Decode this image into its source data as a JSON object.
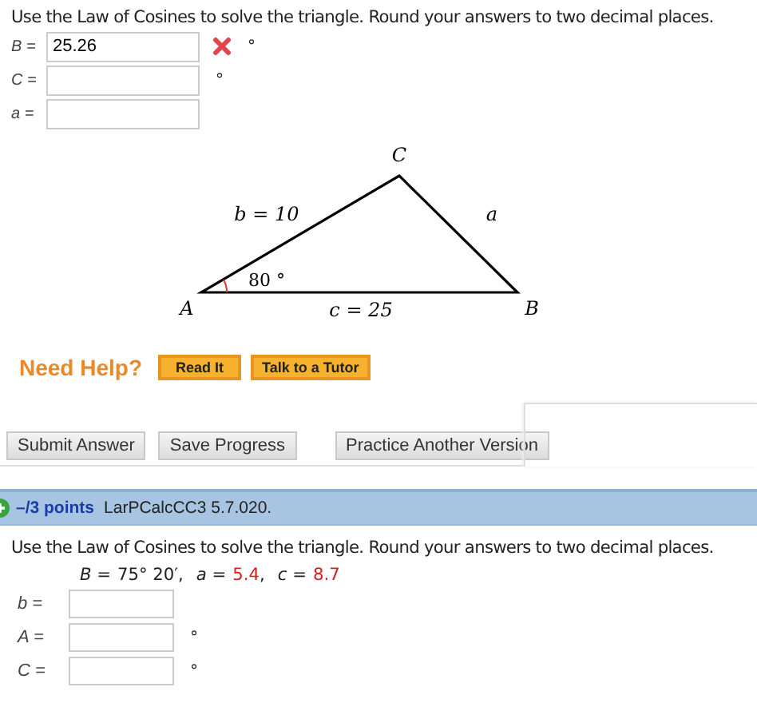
{
  "question_1": {
    "instruction": "Use the Law of Cosines to solve the triangle. Round your answers to two decimal places.",
    "fields": [
      {
        "label": "B =",
        "value": "25.26",
        "unit": "°",
        "incorrect": true
      },
      {
        "label": "C =",
        "unit": "°",
        "incorrect": false
      },
      {
        "label": "a =",
        "incorrect": false
      }
    ],
    "figure": {
      "vertex_a": "A",
      "vertex_b": "B",
      "vertex_c": "C",
      "side_b": "b = 10",
      "side_a": "a",
      "side_c": "c = 25",
      "angle_a": "80 °"
    },
    "help": {
      "label": "Need Help?",
      "buttons": [
        "Read It",
        "Talk to a Tutor"
      ]
    },
    "actions": [
      "Submit Answer",
      "Save Progress",
      "Practice Another Version"
    ]
  },
  "question_2": {
    "points": "–/3 points",
    "source": "LarPCalcCC3 5.7.020.",
    "instruction": "Use the Law of Cosines to solve the triangle. Round your answers to two decimal places.",
    "givens": [
      {
        "label": "B =",
        "value": "75° 20′",
        "separator": ",",
        "highlighted": false
      },
      {
        "label": "a =",
        "value": "5.4",
        "separator": ",",
        "highlighted": true
      },
      {
        "label": "c =",
        "value": "8.7",
        "highlighted": true
      }
    ],
    "fields": [
      {
        "label": "b =",
        "incorrect": false
      },
      {
        "label": "A =",
        "unit": "°",
        "incorrect": false
      },
      {
        "label": "C =",
        "unit": "°",
        "incorrect": false
      }
    ]
  }
}
